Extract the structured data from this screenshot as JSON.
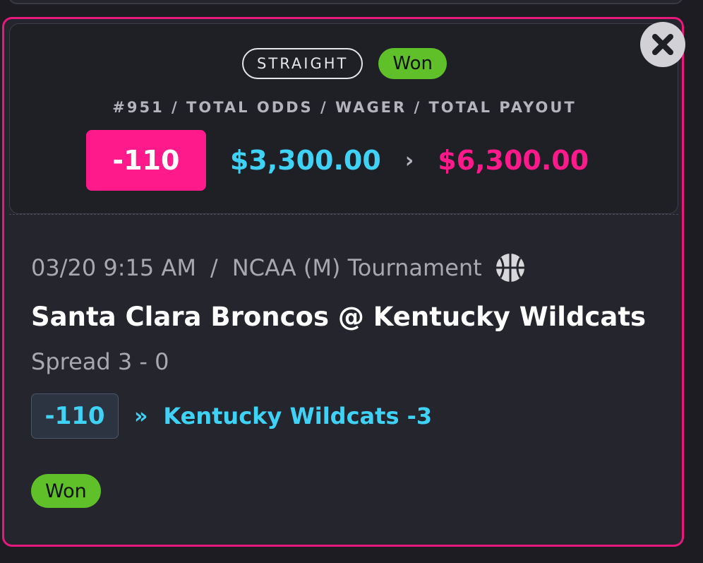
{
  "summary": {
    "bet_type": "STRAIGHT",
    "status": "Won",
    "header": "#951 / TOTAL ODDS / WAGER / TOTAL PAYOUT",
    "total_odds": "-110",
    "wager": "$3,300.00",
    "arrow": "›",
    "total_payout": "$6,300.00"
  },
  "leg": {
    "datetime": "03/20 9:15 AM",
    "separator": "/",
    "league": "NCAA (M) Tournament",
    "sport_icon": "basketball-icon",
    "matchup": "Santa Clara Broncos @ Kentucky Wildcats",
    "market": "Spread 3 - 0",
    "odds": "-110",
    "pick_arrow": "»",
    "pick": "Kentucky Wildcats -3",
    "status": "Won"
  },
  "icons": {
    "close": "close-icon"
  },
  "colors": {
    "accent_pink": "#ff1a8c",
    "accent_cyan": "#3fd2f5",
    "won_green": "#5fc02a",
    "card_border": "#e8197d"
  }
}
